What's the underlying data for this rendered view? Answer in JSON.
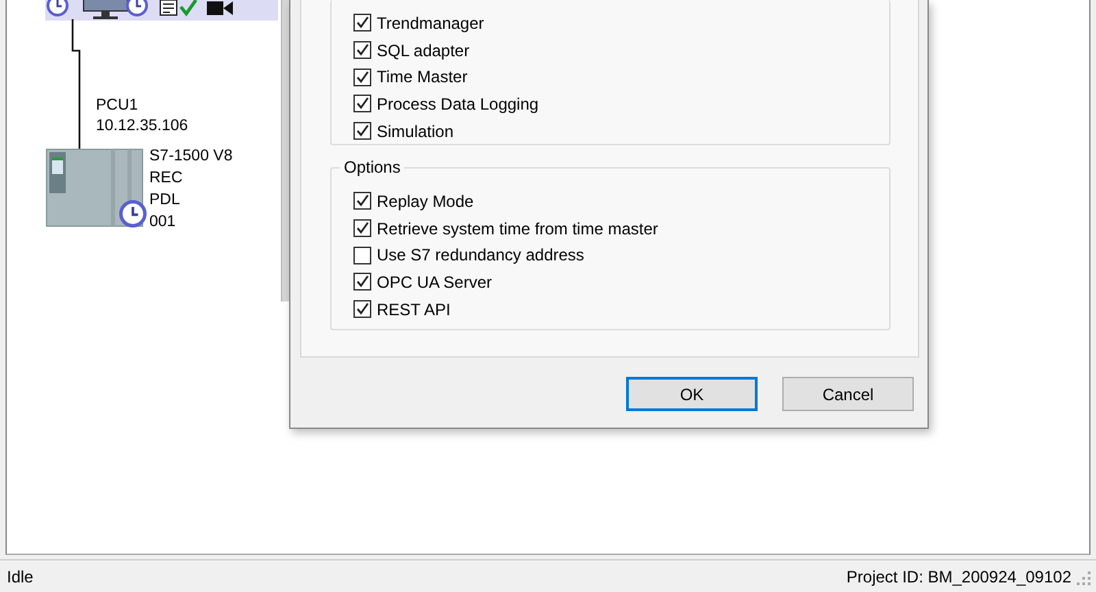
{
  "diagram": {
    "device": {
      "name": "PCU1",
      "address": "10.12.35.106",
      "details": [
        "S7-1500 V8",
        "REC",
        "PDL",
        "001"
      ]
    }
  },
  "dialog": {
    "groups": [
      {
        "items": [
          {
            "label": "Trendmanager",
            "checked": true
          },
          {
            "label": "SQL adapter",
            "checked": true
          },
          {
            "label": "Time Master",
            "checked": true
          },
          {
            "label": "Process Data Logging",
            "checked": true
          },
          {
            "label": "Simulation",
            "checked": true
          }
        ]
      },
      {
        "title": "Options",
        "items": [
          {
            "label": "Replay Mode",
            "checked": true
          },
          {
            "label": "Retrieve system time from time master",
            "checked": true
          },
          {
            "label": "Use S7 redundancy address",
            "checked": false
          },
          {
            "label": "OPC UA Server",
            "checked": true
          },
          {
            "label": "REST API",
            "checked": true
          }
        ]
      }
    ],
    "buttons": [
      {
        "label": "OK",
        "default": true
      },
      {
        "label": "Cancel",
        "default": false
      }
    ]
  },
  "status_bar": {
    "state": "Idle",
    "project": "Project ID: BM_200924_09102"
  }
}
